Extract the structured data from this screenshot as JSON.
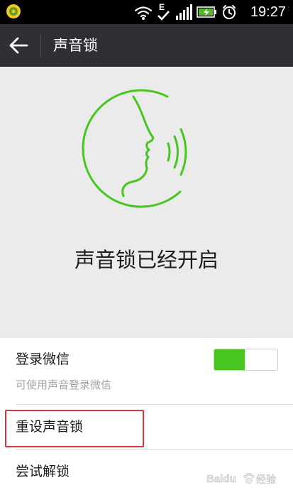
{
  "status_bar": {
    "time": "19:27",
    "network_type": "E",
    "icons": [
      "app-notification-icon",
      "wifi-icon",
      "data-transfer-icon",
      "signal-icon",
      "battery-charging-icon",
      "alarm-icon"
    ]
  },
  "title_bar": {
    "back_icon": "arrow-left-icon",
    "title": "声音锁"
  },
  "hero": {
    "graphic_icon": "voice-face-icon",
    "status_text": "声音锁已经开启",
    "accent_color": "#47c61f"
  },
  "settings": {
    "login": {
      "label": "登录微信",
      "description": "可使用声音登录微信",
      "toggle_on": true
    },
    "reset": {
      "label": "重设声音锁"
    },
    "try_unlock": {
      "label": "尝试解锁"
    }
  },
  "watermark": {
    "brand": "Baidu",
    "suffix": "经验"
  }
}
